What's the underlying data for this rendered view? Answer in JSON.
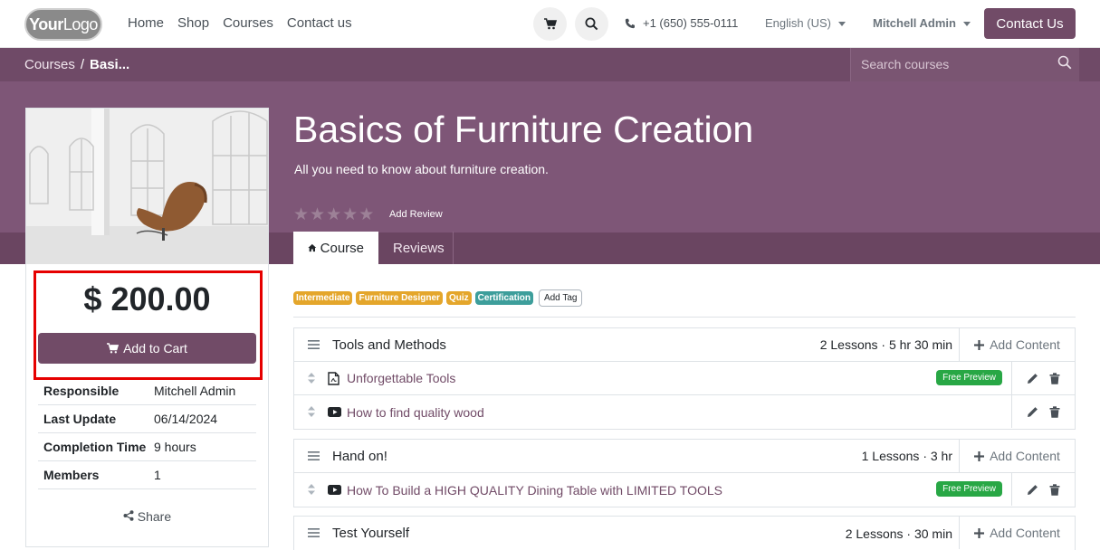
{
  "nav": {
    "logo_bold": "Your",
    "logo_thin": "Logo",
    "links": [
      "Home",
      "Shop",
      "Courses",
      "Contact us"
    ],
    "phone": "+1 (650) 555-0111",
    "language": "English (US)",
    "user": "Mitchell Admin",
    "contact_button": "Contact Us"
  },
  "breadcrumb": {
    "root": "Courses",
    "separator": "/",
    "current": "Basi..."
  },
  "search": {
    "placeholder": "Search courses"
  },
  "course": {
    "title": "Basics of Furniture Creation",
    "subtitle": "All you need to know about furniture creation.",
    "rating": 0,
    "add_review": "Add Review",
    "tabs": [
      "Course",
      "Reviews"
    ]
  },
  "sidebar": {
    "price": "$ 200.00",
    "add_to_cart": "Add to Cart",
    "info": [
      {
        "label": "Responsible",
        "value": "Mitchell Admin"
      },
      {
        "label": "Last Update",
        "value": "06/14/2024"
      },
      {
        "label": "Completion Time",
        "value": "9 hours"
      },
      {
        "label": "Members",
        "value": "1"
      }
    ],
    "share": "Share"
  },
  "tags": [
    {
      "label": "Intermediate",
      "color": "#e4a62b"
    },
    {
      "label": "Furniture Designer",
      "color": "#e4a62b"
    },
    {
      "label": "Quiz",
      "color": "#e4a62b"
    },
    {
      "label": "Certification",
      "color": "#3d9e9b"
    }
  ],
  "add_tag": "Add Tag",
  "add_content": "Add Content",
  "sections": [
    {
      "name": "Tools and Methods",
      "meta": "2 Lessons · 5 hr 30 min",
      "lessons": [
        {
          "name": "Unforgettable Tools",
          "icon": "document-icon",
          "badge": "Free Preview"
        },
        {
          "name": "How to find quality wood",
          "icon": "video-icon",
          "badge": ""
        }
      ]
    },
    {
      "name": "Hand on!",
      "meta": "1 Lessons · 3 hr",
      "lessons": [
        {
          "name": "How To Build a HIGH QUALITY Dining Table with LIMITED TOOLS",
          "icon": "video-icon",
          "badge": "Free Preview"
        }
      ]
    },
    {
      "name": "Test Yourself",
      "meta": "2 Lessons · 30 min",
      "lessons": []
    }
  ],
  "colors": {
    "brand": "#714b67",
    "hero": "#7e5677",
    "free_badge": "#28a745",
    "highlight": "#e60000"
  }
}
